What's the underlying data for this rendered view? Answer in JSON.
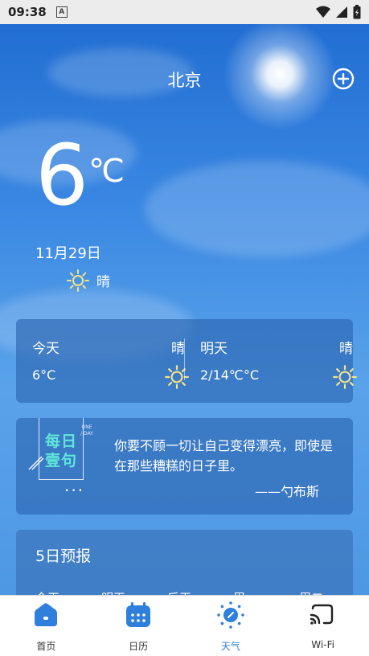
{
  "status_bar": {
    "time": "09:38",
    "notif_icon_letter": "A"
  },
  "header": {
    "city": "北京"
  },
  "current": {
    "temperature": "6",
    "unit": "℃",
    "date": "11月29日",
    "condition": "晴"
  },
  "days": [
    {
      "label": "今天",
      "weather": "晴",
      "temp": "6°C"
    },
    {
      "label": "明天",
      "weather": "晴",
      "temp": "2/14℃°C"
    }
  ],
  "quote": {
    "badge_line1": "每日",
    "badge_line2": "壹句",
    "badge_side": "ONE / DAY",
    "dots": "···",
    "text": "你要不顾一切让自己变得漂亮，即使是在那些糟糕的日子里。",
    "author": "——勺布斯"
  },
  "forecast": {
    "title": "5日预报",
    "days": [
      "今天",
      "明天",
      "后天",
      "周一",
      "周二"
    ]
  },
  "tabs": [
    {
      "label": "首页",
      "icon": "home-icon"
    },
    {
      "label": "日历",
      "icon": "calendar-icon"
    },
    {
      "label": "天气",
      "icon": "weather-icon",
      "active": true
    },
    {
      "label": "Wi-Fi",
      "icon": "cast-icon"
    }
  ],
  "colors": {
    "accent": "#2f7fdc",
    "quote_badge": "#5fe6d8",
    "sun_icon": "#f5e38a"
  }
}
